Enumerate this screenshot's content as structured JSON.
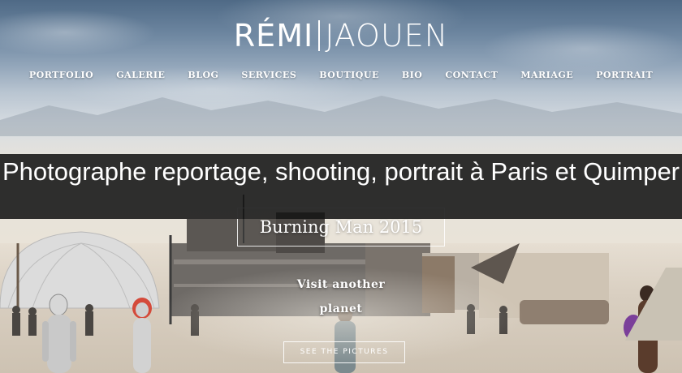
{
  "logo": {
    "first": "RÉMI",
    "last": "JAOUEN"
  },
  "nav": {
    "items": [
      {
        "label": "PORTFOLIO"
      },
      {
        "label": "GALERIE"
      },
      {
        "label": "BLOG"
      },
      {
        "label": "SERVICES"
      },
      {
        "label": "BOUTIQUE"
      },
      {
        "label": "BIO"
      },
      {
        "label": "CONTACT"
      },
      {
        "label": "MARIAGE"
      },
      {
        "label": "PORTRAIT"
      }
    ]
  },
  "banner": {
    "title": "Photographe reportage, shooting, portrait à Paris et Quimper"
  },
  "hero": {
    "event_title": "Burning Man 2015",
    "tagline": "Visit another planet",
    "cta_label": "SEE THE PICTURES"
  },
  "icons": [
    "desert-photo"
  ]
}
